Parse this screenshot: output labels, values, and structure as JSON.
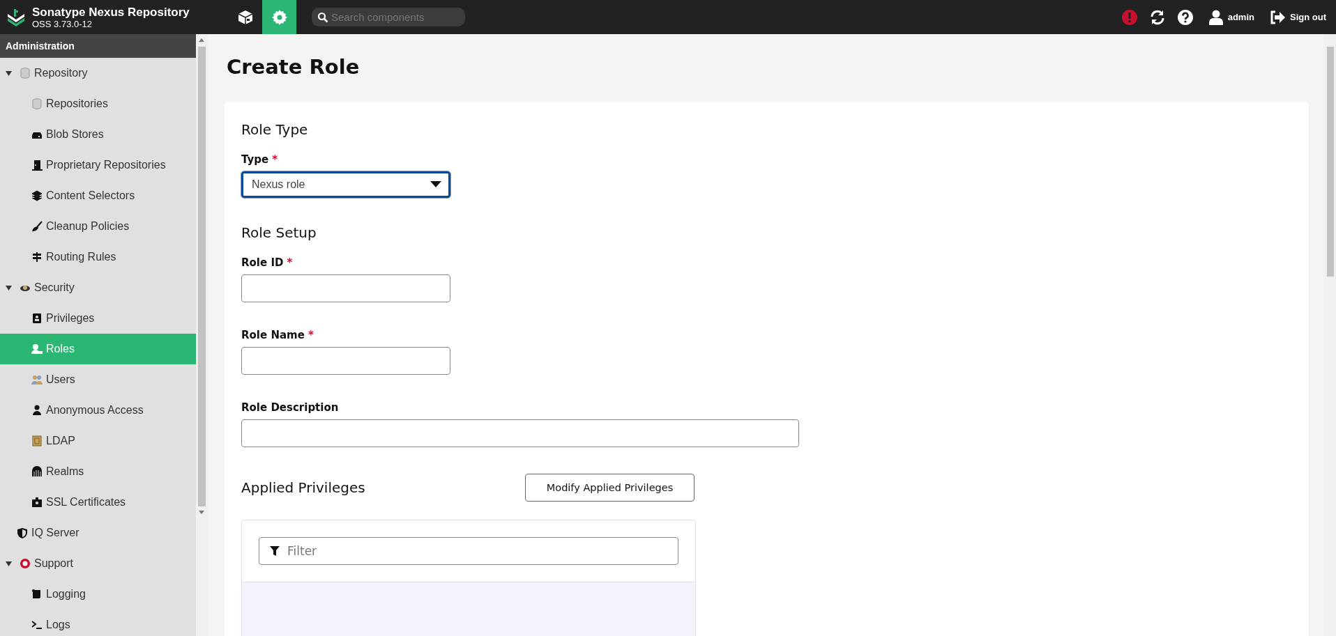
{
  "header": {
    "title": "Sonatype Nexus Repository",
    "version": "OSS 3.73.0-12",
    "modes": [
      {
        "selected": false
      },
      {
        "selected": true
      }
    ],
    "search": {
      "placeholder": "Search components"
    },
    "user": "admin",
    "sign_out": "Sign out"
  },
  "sidebar": {
    "title": "Administration",
    "items": [
      {
        "label": "Repository",
        "expanded": true,
        "selected": false,
        "children": [
          {
            "label": "Repositories",
            "selected": false
          },
          {
            "label": "Blob Stores",
            "selected": false
          },
          {
            "label": "Proprietary Repositories",
            "selected": false
          },
          {
            "label": "Content Selectors",
            "selected": false
          },
          {
            "label": "Cleanup Policies",
            "selected": false
          },
          {
            "label": "Routing Rules",
            "selected": false
          }
        ]
      },
      {
        "label": "Security",
        "expanded": true,
        "selected": false,
        "children": [
          {
            "label": "Privileges",
            "selected": false
          },
          {
            "label": "Roles",
            "selected": true
          },
          {
            "label": "Users",
            "selected": false
          },
          {
            "label": "Anonymous Access",
            "selected": false
          },
          {
            "label": "LDAP",
            "selected": false
          },
          {
            "label": "Realms",
            "selected": false
          },
          {
            "label": "SSL Certificates",
            "selected": false
          }
        ]
      },
      {
        "label": "IQ Server",
        "selected": false
      },
      {
        "label": "Support",
        "expanded": true,
        "selected": false,
        "children": [
          {
            "label": "Logging",
            "selected": false
          },
          {
            "label": "Logs",
            "selected": false
          }
        ]
      }
    ]
  },
  "page": {
    "title": "Create Role",
    "sections": [
      {
        "heading": "Role Type",
        "fields": [
          {
            "kind": "select",
            "label": "Type",
            "required_mark": "*",
            "value": "Nexus role"
          }
        ]
      },
      {
        "heading": "Role Setup",
        "fields": [
          {
            "kind": "text",
            "label": "Role ID",
            "required_mark": "*"
          },
          {
            "kind": "text",
            "label": "Role Name",
            "required_mark": "*"
          },
          {
            "kind": "wide",
            "label": "Role Description"
          }
        ]
      }
    ],
    "privileges": {
      "heading": "Applied Privileges",
      "button": "Modify Applied Privileges",
      "filter": {
        "placeholder": "Filter"
      }
    }
  }
}
